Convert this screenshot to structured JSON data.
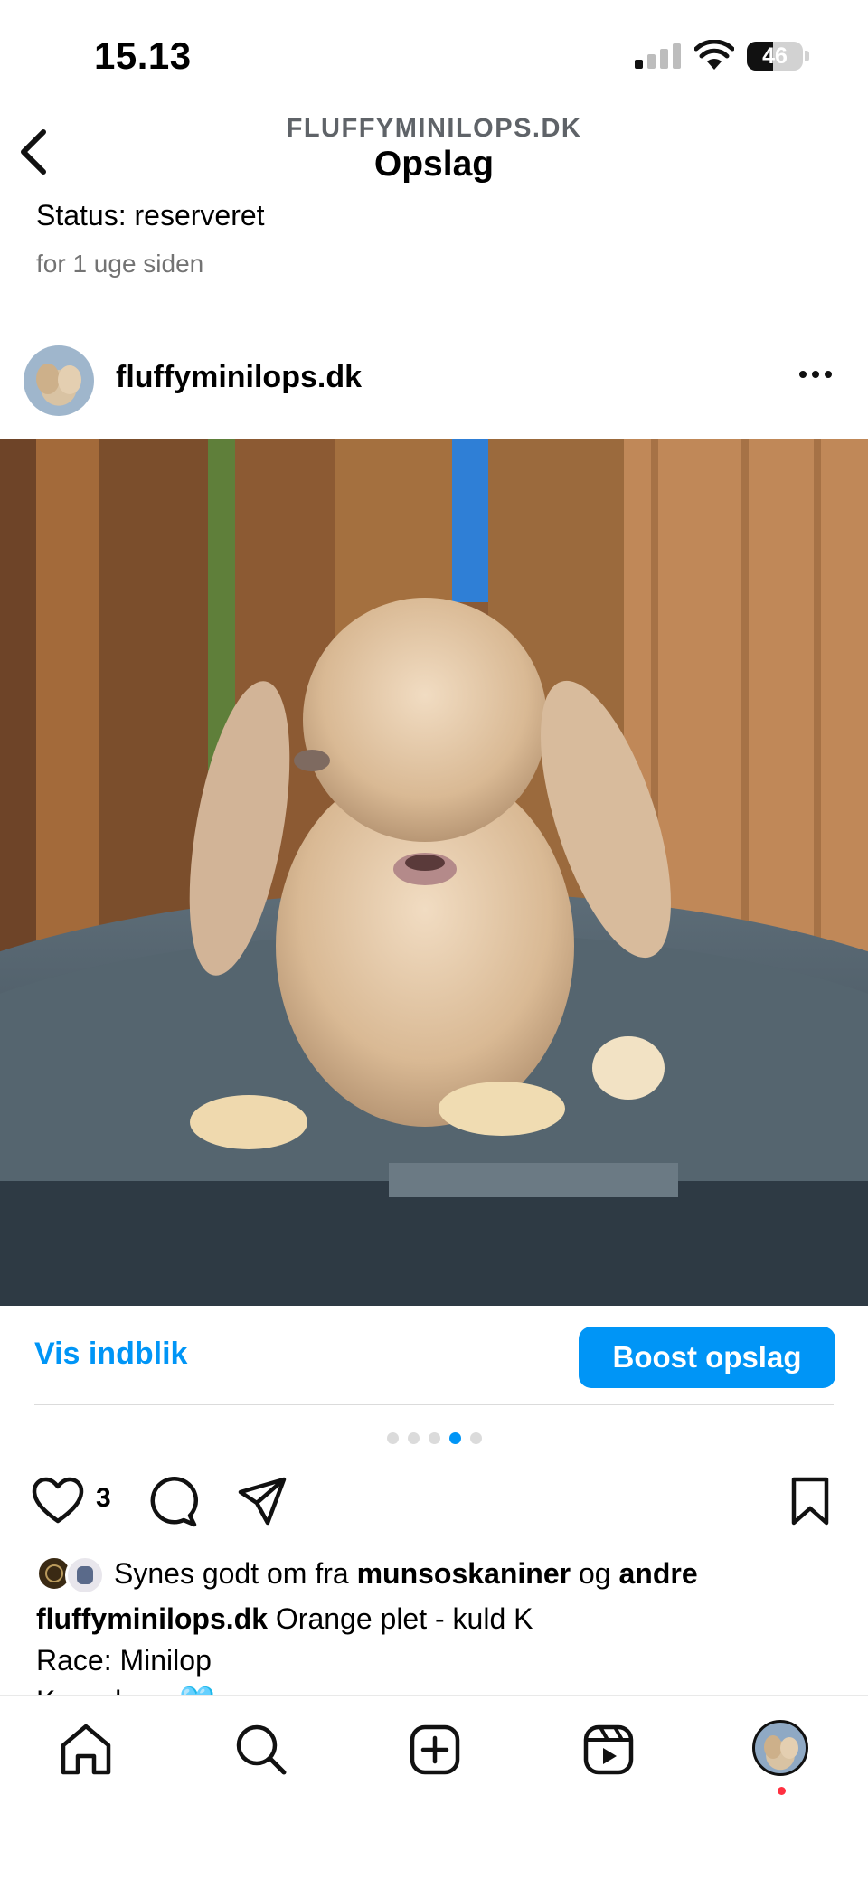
{
  "status_bar": {
    "time": "15.13",
    "battery": "46"
  },
  "header": {
    "account": "FLUFFYMINILOPS.DK",
    "title": "Opslag"
  },
  "previous_post": {
    "status_text": "Status: reserveret",
    "time_ago": "for 1 uge siden"
  },
  "post": {
    "username": "fluffyminilops.dk",
    "image_description_icon": "rabbit-photo",
    "carousel": {
      "total": 5,
      "active_index": 3
    },
    "insights_label": "Vis indblik",
    "boost_label": "Boost opslag",
    "likes_count": "3",
    "liked_by": {
      "prefix": "Synes godt om fra",
      "user": "munsoskaniner",
      "joiner": "og",
      "others": "andre"
    },
    "caption": {
      "username": "fluffyminilops.dk",
      "line1": "Orange plet - kuld K",
      "line2": "Race: Minilop",
      "line3": "Køn: dreng🩵"
    }
  },
  "nav": {
    "icons": [
      "home-icon",
      "search-icon",
      "create-icon",
      "reels-icon",
      "profile-avatar"
    ]
  },
  "colors": {
    "accent": "#0095f6",
    "notification": "#ff3040"
  }
}
